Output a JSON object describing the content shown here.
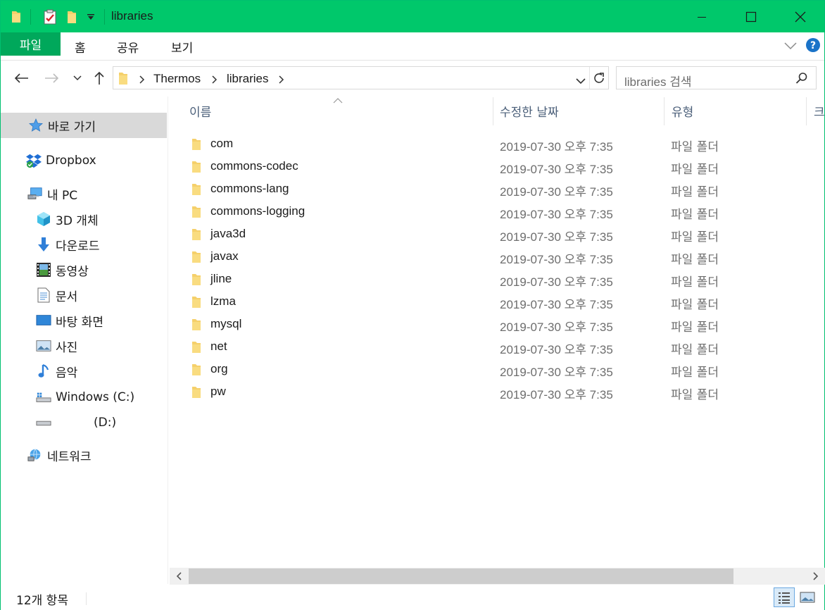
{
  "window": {
    "title": "libraries"
  },
  "ribbon": {
    "file": "파일",
    "tabs": [
      "홈",
      "공유",
      "보기"
    ]
  },
  "address": {
    "segments": [
      "Thermos",
      "libraries"
    ]
  },
  "search": {
    "placeholder": "libraries 검색"
  },
  "nav": {
    "quick_access": "바로 가기",
    "dropbox": "Dropbox",
    "this_pc": "내 PC",
    "items": [
      "3D 개체",
      "다운로드",
      "동영상",
      "문서",
      "바탕 화면",
      "사진",
      "음악",
      "Windows (C:)",
      "(D:)"
    ],
    "network": "네트워크"
  },
  "columns": {
    "name": "이름",
    "date": "수정한 날짜",
    "type": "유형",
    "size_partial": "크"
  },
  "files": [
    {
      "name": "com",
      "date": "2019-07-30 오후 7:35",
      "type": "파일 폴더"
    },
    {
      "name": "commons-codec",
      "date": "2019-07-30 오후 7:35",
      "type": "파일 폴더"
    },
    {
      "name": "commons-lang",
      "date": "2019-07-30 오후 7:35",
      "type": "파일 폴더"
    },
    {
      "name": "commons-logging",
      "date": "2019-07-30 오후 7:35",
      "type": "파일 폴더"
    },
    {
      "name": "java3d",
      "date": "2019-07-30 오후 7:35",
      "type": "파일 폴더"
    },
    {
      "name": "javax",
      "date": "2019-07-30 오후 7:35",
      "type": "파일 폴더"
    },
    {
      "name": "jline",
      "date": "2019-07-30 오후 7:35",
      "type": "파일 폴더"
    },
    {
      "name": "lzma",
      "date": "2019-07-30 오후 7:35",
      "type": "파일 폴더"
    },
    {
      "name": "mysql",
      "date": "2019-07-30 오후 7:35",
      "type": "파일 폴더"
    },
    {
      "name": "net",
      "date": "2019-07-30 오후 7:35",
      "type": "파일 폴더"
    },
    {
      "name": "org",
      "date": "2019-07-30 오후 7:35",
      "type": "파일 폴더"
    },
    {
      "name": "pw",
      "date": "2019-07-30 오후 7:35",
      "type": "파일 폴더"
    }
  ],
  "status": {
    "count": "12개 항목"
  },
  "colors": {
    "titlebar": "#00c86b",
    "file_tab": "#00a85b",
    "help": "#1a73c8"
  }
}
